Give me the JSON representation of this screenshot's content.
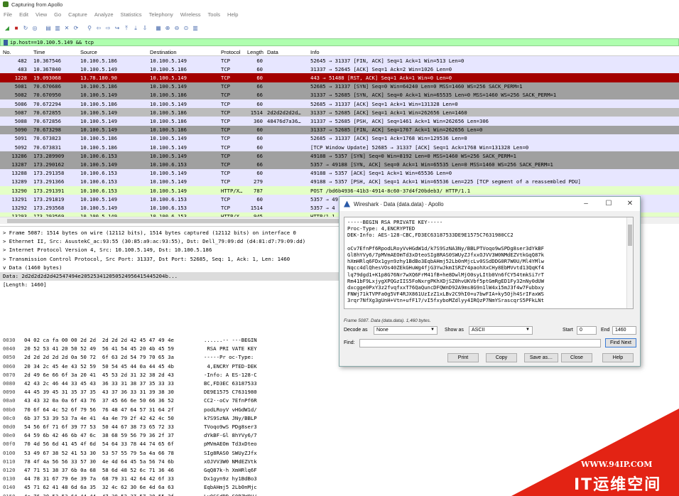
{
  "window": {
    "title": "Capturing from Apollo"
  },
  "menu": [
    "File",
    "Edit",
    "View",
    "Go",
    "Capture",
    "Analyze",
    "Statistics",
    "Telephony",
    "Wireless",
    "Tools",
    "Help"
  ],
  "toolbar_icons": [
    "shark-fin-icon",
    "stop-icon",
    "restart-icon",
    "options-icon",
    "open-icon",
    "save-icon",
    "close-file-icon",
    "reload-icon",
    "find-icon",
    "back-icon",
    "forward-icon",
    "goto-icon",
    "first-icon",
    "last-icon",
    "autoscroll-icon",
    "colorize-icon",
    "zoom-in-icon",
    "zoom-out-icon",
    "zoom-reset-icon",
    "resize-columns-icon"
  ],
  "filter": {
    "value": "ip.host==10.100.5.149 && tcp"
  },
  "columns": {
    "no": "No.",
    "time": "Time",
    "source": "Source",
    "destination": "Destination",
    "protocol": "Protocol",
    "length": "Length",
    "data": "Data",
    "info": "Info"
  },
  "colors": {
    "tcp": "#e7e6ff",
    "gray": "#a0a0a0",
    "rst": "#a40000",
    "http": "#e4ffc7",
    "selected": "#bcbcbc"
  },
  "packets": [
    {
      "no": "482",
      "time": "10.367546",
      "src": "10.100.5.186",
      "dst": "10.100.5.149",
      "proto": "TCP",
      "len": "60",
      "data": "",
      "info": "52645 → 31337 [FIN, ACK] Seq=1 Ack=1 Win=513 Len=0",
      "style": "tcp"
    },
    {
      "no": "483",
      "time": "10.367840",
      "src": "10.100.5.149",
      "dst": "10.100.5.186",
      "proto": "TCP",
      "len": "60",
      "data": "",
      "info": "31337 → 52645 [ACK] Seq=1 Ack=2 Win=1026 Len=0",
      "style": "tcp"
    },
    {
      "no": "1228",
      "time": "19.093068",
      "src": "13.78.180.90",
      "dst": "10.100.5.149",
      "proto": "TCP",
      "len": "60",
      "data": "",
      "info": "443 → 51488 [RST, ACK] Seq=1 Ack=1 Win=0 Len=0",
      "style": "rst"
    },
    {
      "no": "5081",
      "time": "70.670686",
      "src": "10.100.5.186",
      "dst": "10.100.5.149",
      "proto": "TCP",
      "len": "66",
      "data": "",
      "info": "52685 → 31337 [SYN] Seq=0 Win=64240 Len=0 MSS=1460 WS=256 SACK_PERM=1",
      "style": "gray"
    },
    {
      "no": "5082",
      "time": "70.670950",
      "src": "10.100.5.149",
      "dst": "10.100.5.186",
      "proto": "TCP",
      "len": "66",
      "data": "",
      "info": "31337 → 52685 [SYN, ACK] Seq=0 Ack=1 Win=65535 Len=0 MSS=1460 WS=256 SACK_PERM=1",
      "style": "gray"
    },
    {
      "no": "5086",
      "time": "70.672294",
      "src": "10.100.5.186",
      "dst": "10.100.5.149",
      "proto": "TCP",
      "len": "60",
      "data": "",
      "info": "52685 → 31337 [ACK] Seq=1 Ack=1 Win=131328 Len=0",
      "style": "tcp"
    },
    {
      "no": "5087",
      "time": "70.672855",
      "src": "10.100.5.149",
      "dst": "10.100.5.186",
      "proto": "TCP",
      "len": "1514",
      "data": "2d2d2d2d2d…",
      "info": "31337 → 52685 [ACK] Seq=1 Ack=1 Win=262656 Len=1460",
      "style": "selected"
    },
    {
      "no": "5088",
      "time": "70.672856",
      "src": "10.100.5.149",
      "dst": "10.100.5.186",
      "proto": "TCP",
      "len": "360",
      "data": "48476d7a36…",
      "info": "31337 → 52685 [PSH, ACK] Seq=1461 Ack=1 Win=262656 Len=306",
      "style": "tcp"
    },
    {
      "no": "5090",
      "time": "70.673298",
      "src": "10.100.5.149",
      "dst": "10.100.5.186",
      "proto": "TCP",
      "len": "60",
      "data": "",
      "info": "31337 → 52685 [FIN, ACK] Seq=1767 Ack=1 Win=262656 Len=0",
      "style": "gray"
    },
    {
      "no": "5091",
      "time": "70.673823",
      "src": "10.100.5.186",
      "dst": "10.100.5.149",
      "proto": "TCP",
      "len": "60",
      "data": "",
      "info": "52685 → 31337 [ACK] Seq=1 Ack=1768 Win=129536 Len=0",
      "style": "tcp"
    },
    {
      "no": "5092",
      "time": "70.673831",
      "src": "10.100.5.186",
      "dst": "10.100.5.149",
      "proto": "TCP",
      "len": "60",
      "data": "",
      "info": "[TCP Window Update] 52685 → 31337 [ACK] Seq=1 Ack=1768 Win=131328 Len=0",
      "style": "tcp"
    },
    {
      "no": "13286",
      "time": "173.289909",
      "src": "10.100.6.153",
      "dst": "10.100.5.149",
      "proto": "TCP",
      "len": "66",
      "data": "",
      "info": "49188 → 5357 [SYN] Seq=0 Win=8192 Len=0 MSS=1460 WS=256 SACK_PERM=1",
      "style": "gray"
    },
    {
      "no": "13287",
      "time": "173.290162",
      "src": "10.100.5.149",
      "dst": "10.100.6.153",
      "proto": "TCP",
      "len": "66",
      "data": "",
      "info": "5357 → 49188 [SYN, ACK] Seq=0 Ack=1 Win=65535 Len=0 MSS=1460 WS=256 SACK_PERM=1",
      "style": "gray"
    },
    {
      "no": "13288",
      "time": "173.291358",
      "src": "10.100.6.153",
      "dst": "10.100.5.149",
      "proto": "TCP",
      "len": "60",
      "data": "",
      "info": "49188 → 5357 [ACK] Seq=1 Ack=1 Win=65536 Len=0",
      "style": "tcp"
    },
    {
      "no": "13289",
      "time": "173.291366",
      "src": "10.100.6.153",
      "dst": "10.100.5.149",
      "proto": "TCP",
      "len": "279",
      "data": "",
      "info": "49188 → 5357 [PSH, ACK] Seq=1 Ack=1 Win=65536 Len=225 [TCP segment of a reassembled PDU]",
      "style": "tcp"
    },
    {
      "no": "13290",
      "time": "173.291391",
      "src": "10.100.6.153",
      "dst": "10.100.5.149",
      "proto": "HTTP/X…",
      "len": "787",
      "data": "",
      "info": "POST /bd6b4936-41b3-4914-8c60-37d4f20bdeb3/ HTTP/1.1",
      "style": "http"
    },
    {
      "no": "13291",
      "time": "173.291819",
      "src": "10.100.5.149",
      "dst": "10.100.6.153",
      "proto": "TCP",
      "len": "60",
      "data": "",
      "info": "5357 → 49188 [ACK] Seq=1 Ack=959 Win=261632 Len=0",
      "style": "tcp"
    },
    {
      "no": "13292",
      "time": "173.293568",
      "src": "10.100.5.149",
      "dst": "10.100.6.153",
      "proto": "TCP",
      "len": "1514",
      "data": "",
      "info": "5357 → 4",
      "style": "tcp"
    },
    {
      "no": "13293",
      "time": "173.293569",
      "src": "10.100.5.149",
      "dst": "10.100.6.153",
      "proto": "HTTP/X…",
      "len": "945",
      "data": "",
      "info": "HTTP/1.1",
      "style": "http"
    },
    {
      "no": "13294",
      "time": "173.294480",
      "src": "10.100.6.153",
      "dst": "10.100.5.149",
      "proto": "TCP",
      "len": "60",
      "data": "",
      "info": "49188 →",
      "style": "tcp"
    }
  ],
  "details": [
    {
      "text": "> Frame 5087: 1514 bytes on wire (12112 bits), 1514 bytes captured (12112 bits) on interface 0",
      "sel": false
    },
    {
      "text": "> Ethernet II, Src: AsustekC_ac:93:55 (30:85:a9:ac:93:55), Dst: Dell_79:09:dd (d4:81:d7:79:09:dd)",
      "sel": false
    },
    {
      "text": "> Internet Protocol Version 4, Src: 10.100.5.149, Dst: 10.100.5.186",
      "sel": false
    },
    {
      "text": "> Transmission Control Protocol, Src Port: 31337, Dst Port: 52685, Seq: 1, Ack: 1, Len: 1460",
      "sel": false
    },
    {
      "text": "v Data (1460 bytes)",
      "sel": false
    },
    {
      "text": "    Data: 2d2d2d2d2d42547494e205253412050524956415445204b...",
      "sel": true
    },
    {
      "text": "    [Length: 1460]",
      "sel": false
    }
  ],
  "hex": [
    {
      "off": "0030",
      "hex": "04 02 ca fa 00 00 2d 2d  2d 2d 2d 42 45 47 49 4e",
      "asc": "......-- ---BEGIN"
    },
    {
      "off": "0040",
      "hex": "20 52 53 41 20 50 52 49  56 41 54 45 20 4b 45 59",
      "asc": " RSA PRI VATE KEY"
    },
    {
      "off": "0050",
      "hex": "2d 2d 2d 2d 2d 0a 50 72  6f 63 2d 54 79 70 65 3a",
      "asc": "-----Pr oc-Type:"
    },
    {
      "off": "0060",
      "hex": "20 34 2c 45 4e 43 52 59  50 54 45 44 0a 44 45 4b",
      "asc": " 4,ENCRY PTED·DEK"
    },
    {
      "off": "0070",
      "hex": "2d 49 6e 66 6f 3a 20 41  45 53 2d 31 32 38 2d 43",
      "asc": "-Info: A ES-128-C"
    },
    {
      "off": "0080",
      "hex": "42 43 2c 46 44 33 45 43  36 33 31 38 37 35 33 33",
      "asc": "BC,FD3EC 63187533"
    },
    {
      "off": "0090",
      "hex": "44 45 39 45 31 35 37 35  43 37 36 33 31 39 38 30",
      "asc": "DE9E1575 C7631980"
    },
    {
      "off": "00a0",
      "hex": "43 43 32 0a 0a 6f 43 76  37 45 66 6e 50 66 36 52",
      "asc": "CC2··oCv 7EfnPf6R"
    },
    {
      "off": "00b0",
      "hex": "70 6f 64 4c 52 6f 79 56  76 48 47 64 57 31 64 2f",
      "asc": "podLRoyV vHGdW1d/"
    },
    {
      "off": "00c0",
      "hex": "6b 37 53 39 53 7a 4e 41  4a 4e 79 2f 42 42 4c 50",
      "asc": "k7S9SzNA JNy/BBLP"
    },
    {
      "off": "00d0",
      "hex": "54 56 6f 71 6f 39 77 53  50 44 67 38 73 65 72 33",
      "asc": "TVoqo9wS PDg8ser3"
    },
    {
      "off": "00e0",
      "hex": "64 59 6b 42 46 6b 47 6c  38 68 59 56 79 36 2f 37",
      "asc": "dYkBF-Gl 8hYVy6/7"
    },
    {
      "off": "00f0",
      "hex": "70 4d 56 6d 41 45 4f 6d  54 64 33 78 44 74 65 6f",
      "asc": "pMVmAEOm Td3xDteo"
    },
    {
      "off": "0100",
      "hex": "53 49 67 38 52 41 53 30  53 57 55 79 5a 4a 66 78",
      "asc": "SIg8RAS0 SWUyZJfx"
    },
    {
      "off": "0110",
      "hex": "78 4f 4a 56 56 33 57 30  4e 4d 64 45 5a 56 74 6b",
      "asc": "xOJVV3W0 NMdEZVtk"
    },
    {
      "off": "0120",
      "hex": "47 71 51 38 37 6b 0a 68  58 6d 48 52 6c 71 36 46",
      "asc": "GqQ87k·h XmHRlq6F"
    },
    {
      "off": "0130",
      "hex": "44 78 31 67 79 6e 39 7a  68 79 31 42 64 42 6f 33",
      "asc": "Dx1gyn9z hy1BdBo3"
    },
    {
      "off": "0140",
      "hex": "45 71 62 41 48 6d 6a 35  32 4c 62 30 6e 4d 6a 63",
      "asc": "EqbAHmj5 2Lb0nMjc"
    },
    {
      "off": "0150",
      "hex": "4c 76 30 53 53 64 44 44  47 30 52 37 57 30 55 2f",
      "asc": "Lv0SSdDD G0R7W0U/"
    },
    {
      "off": "0160",
      "hex": "4d 6c 34 59 4d 6c 77 0a  4e 71 63 63 34 64 6c 51",
      "asc": "Ml4YMlw· Nqcc4dlQ"
    },
    {
      "off": "0170",
      "hex": "68 65 73 56 4f 73 34 30  5a 45 6b 47 48 75 57 67",
      "asc": "hesVOs40 ZEkGHuWg"
    }
  ],
  "dialog": {
    "title": "Wireshark · Data (data.data) · Apollo",
    "lines": [
      "-----BEGIN RSA PRIVATE KEY-----",
      "Proc-Type: 4,ENCRYPTED",
      "DEK-Info: AES-128-CBC,FD3EC63187533DE9E1575C7631980CC2",
      "",
      "oCv7EfnPf6RpodLRoyVvHGdW1d/k7S9SzNA3Ny/BBLPTVoqo9wSPDg8ser3dYkBF",
      "Gl8hYVy6/7pMVmAEOmTd3xDteoSIg8RAS0SWUyZJfxxOJVV3W0NMdEZVtkGqQ87k",
      "hXmHRlq6FDx1gyn9zhy1BdBo3EqbAHmj52Lb0nMjcLv0SSdDDG0R7W0U/Ml4YMlw",
      "Nqcc4dlQhesVOs40ZEkGHuWg4fjG3YwJkmISRZY4paohXxCHy8EbMVvtd13QqKf4",
      "lq79dgd1+K1p8G76Nr7wXQ6FrM41fB+he8DwlMjO0syLItb0Vn6fCY54tmkSi7rT",
      "Rm41bF9LxjygXPQGzIIS5FoNxrgPKhXDjSZ0hvUKVbf5ptGmRgED1Fy32nNy0dUW",
      "dxcgge0PxY3z2fvqfxxT76QaQuncDFQWnD92A9ms8G9n1lW4x15mJ3f4w7Fubbxy",
      "FNWj71kTVPFa0g5VF4RJX861UzIzZ1xLBv2C9hI0+u7bwFIA+ky5Ojh4SrIFaxWS",
      "3rqr7NfXg3gUnH+Vtn+ufF17/vI5fxyboMZdlyy4IRQzP7NmYSrascqrS5PFkLNt"
    ],
    "frame_info": "Frame 5087. Data (data.data). 1,460 bytes.",
    "decode_label": "Decode as",
    "decode_value": "None",
    "show_label": "Show as",
    "show_value": "ASCII",
    "start_label": "Start",
    "start_value": "0",
    "end_label": "End",
    "end_value": "1460",
    "find_label": "Find:",
    "find_value": "",
    "find_next": "Find Next",
    "buttons": {
      "print": "Print",
      "copy": "Copy",
      "save": "Save as…",
      "close": "Close",
      "help": "Help"
    }
  },
  "watermark": {
    "url": "WWW.94IP.COM",
    "name": "IT运维空间"
  }
}
